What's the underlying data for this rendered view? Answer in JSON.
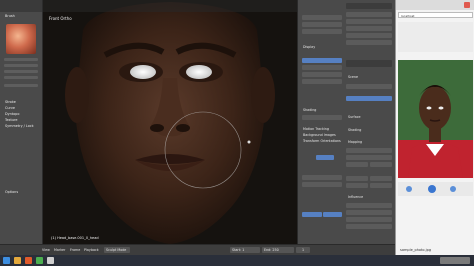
{
  "viewport": {
    "title": "Front Ortho",
    "object_label": "(1) Head_base.001_0_head"
  },
  "tool_shelf": {
    "top_labels": [
      "Brush"
    ],
    "items": [
      "Stroke",
      "Curve",
      "Dyntopo",
      "Texture",
      "Symmetry / Lock",
      "Options"
    ]
  },
  "properties": {
    "sections": [
      "Display",
      "Shading",
      "Motion Tracking",
      "Background Images",
      "Transform Orientations"
    ],
    "tabs": [
      "Scene",
      "RenderLayers",
      "Object",
      "Modifiers",
      "Material"
    ],
    "material_section": [
      "Surface",
      "Shading",
      "Mapping",
      "Diffuse",
      "Specular",
      "Influence"
    ]
  },
  "timeline": {
    "items": [
      "View",
      "Marker",
      "Frame",
      "Playback"
    ],
    "start_label": "Start: 1",
    "end_label": "End: 250",
    "current": "1",
    "mode": "Sculpt Mode"
  },
  "browser": {
    "address": "localhost",
    "filename": "sample_photo.jpg"
  },
  "colors": {
    "accent_blue": "#5680c2",
    "panel_bg": "#4a4a4a",
    "shirt_red": "#c0232f"
  }
}
